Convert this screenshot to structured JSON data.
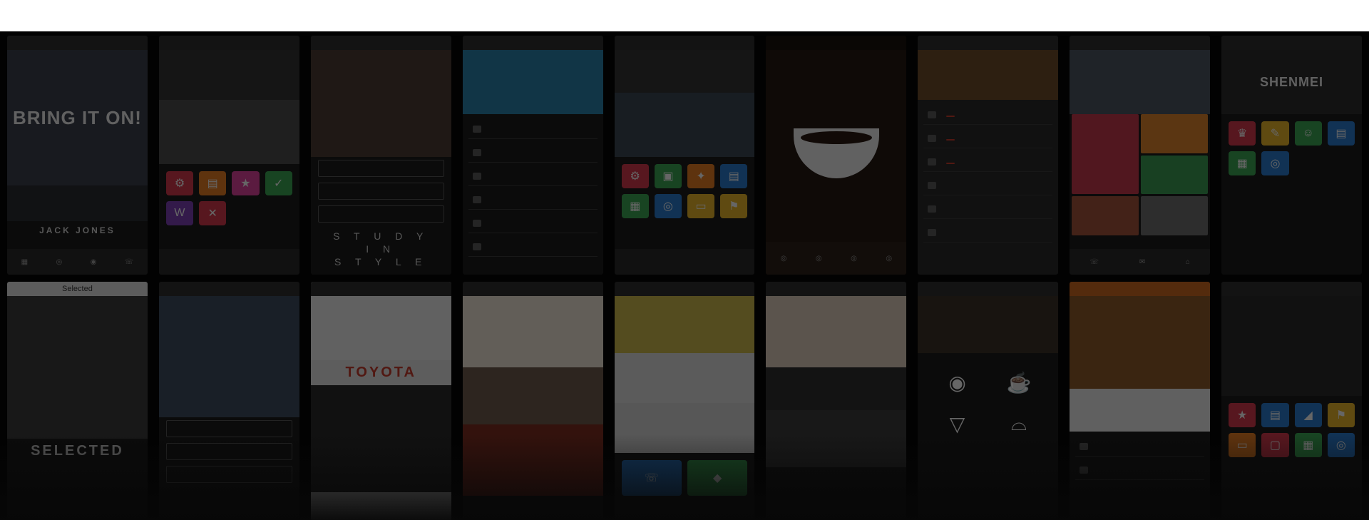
{
  "screens": [
    {
      "status": "",
      "hero": "BRING IT ON!",
      "sub": "",
      "brand": "JACK JONES"
    },
    {
      "status": "",
      "hero": "",
      "sub": ""
    },
    {
      "status": "",
      "hero": "",
      "sub": "",
      "caption": [
        "S T U D Y",
        "I N",
        "S T Y L E"
      ]
    },
    {
      "status": "",
      "hero": "",
      "sub": ""
    },
    {
      "status": "",
      "hero": "",
      "sub": ""
    },
    {
      "status": "",
      "hero": "",
      "sub": ""
    },
    {
      "status": "",
      "hero": "",
      "sub": ""
    },
    {
      "status": "",
      "hero": "",
      "sub": ""
    },
    {
      "status": "",
      "hero": "SHENMEI",
      "sub": ""
    },
    {
      "status": "Selected",
      "hero": "",
      "sub": "",
      "caption_text": "SELECTED"
    },
    {
      "status": "",
      "hero": "",
      "sub": ""
    },
    {
      "status": "",
      "hero": "",
      "sub": "",
      "brand": "TOYOTA"
    },
    {
      "status": "",
      "hero": "",
      "sub": ""
    },
    {
      "status": "",
      "hero": "",
      "sub": ""
    },
    {
      "status": "",
      "hero": "",
      "sub": ""
    },
    {
      "status": "",
      "hero": "",
      "sub": ""
    },
    {
      "status": "",
      "hero": "",
      "sub": ""
    },
    {
      "status": "",
      "hero": "",
      "sub": ""
    }
  ],
  "colors": {
    "red": "#d0384a",
    "orange": "#e07a22",
    "pink": "#d9409a",
    "green": "#3aa351",
    "blue": "#2a78c8",
    "purple": "#7b3fb0",
    "yellow": "#e2b12a",
    "teal": "#2aa7a7",
    "grey": "#6b6b6b"
  },
  "icons": [
    "grid-icon",
    "compass-icon",
    "cart-icon",
    "phone-icon",
    "shirt-icon",
    "gear-icon",
    "star-icon",
    "calendar-icon",
    "map-icon"
  ]
}
